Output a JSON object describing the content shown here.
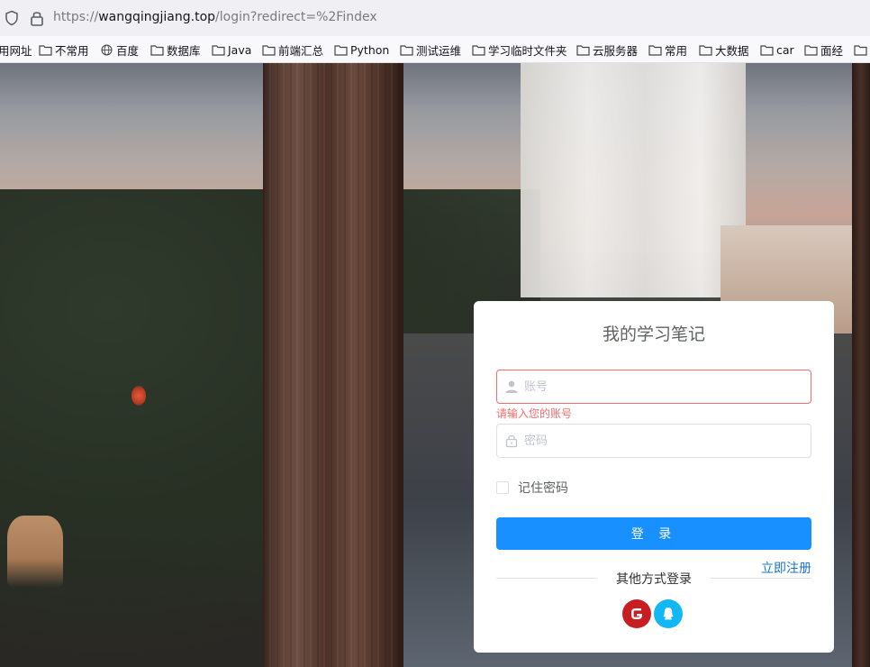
{
  "browser": {
    "url_prefix": "https://",
    "url_domain": "wangqingjiang.top",
    "url_path": "/login?redirect=%2Findex"
  },
  "bookmarks": [
    {
      "label": "用网址",
      "icon": "none"
    },
    {
      "label": "不常用",
      "icon": "folder-icon"
    },
    {
      "label": "百度",
      "icon": "globe-icon"
    },
    {
      "label": "数据库",
      "icon": "folder-icon"
    },
    {
      "label": "Java",
      "icon": "folder-icon"
    },
    {
      "label": "前端汇总",
      "icon": "folder-icon"
    },
    {
      "label": "Python",
      "icon": "folder-icon"
    },
    {
      "label": "测试运维",
      "icon": "folder-icon"
    },
    {
      "label": "学习临时文件夹",
      "icon": "folder-icon"
    },
    {
      "label": "云服务器",
      "icon": "folder-icon"
    },
    {
      "label": "常用",
      "icon": "folder-icon"
    },
    {
      "label": "大数据",
      "icon": "folder-icon"
    },
    {
      "label": "car",
      "icon": "folder-icon"
    },
    {
      "label": "面经",
      "icon": "folder-icon"
    },
    {
      "label": "",
      "icon": "folder-icon"
    }
  ],
  "login": {
    "title": "我的学习笔记",
    "username_placeholder": "账号",
    "username_value": "",
    "username_error": "请输入您的账号",
    "password_placeholder": "密码",
    "password_value": "",
    "remember_label": "记住密码",
    "remember_checked": false,
    "login_button": "登 录",
    "register_link": "立即注册",
    "other_methods": "其他方式登录",
    "social": [
      {
        "name": "gitee",
        "color": "#c71d23"
      },
      {
        "name": "qq",
        "color": "#12b7f5"
      }
    ]
  },
  "colors": {
    "primary": "#1890ff",
    "error": "#f56c6c",
    "link": "#1a73c8"
  }
}
